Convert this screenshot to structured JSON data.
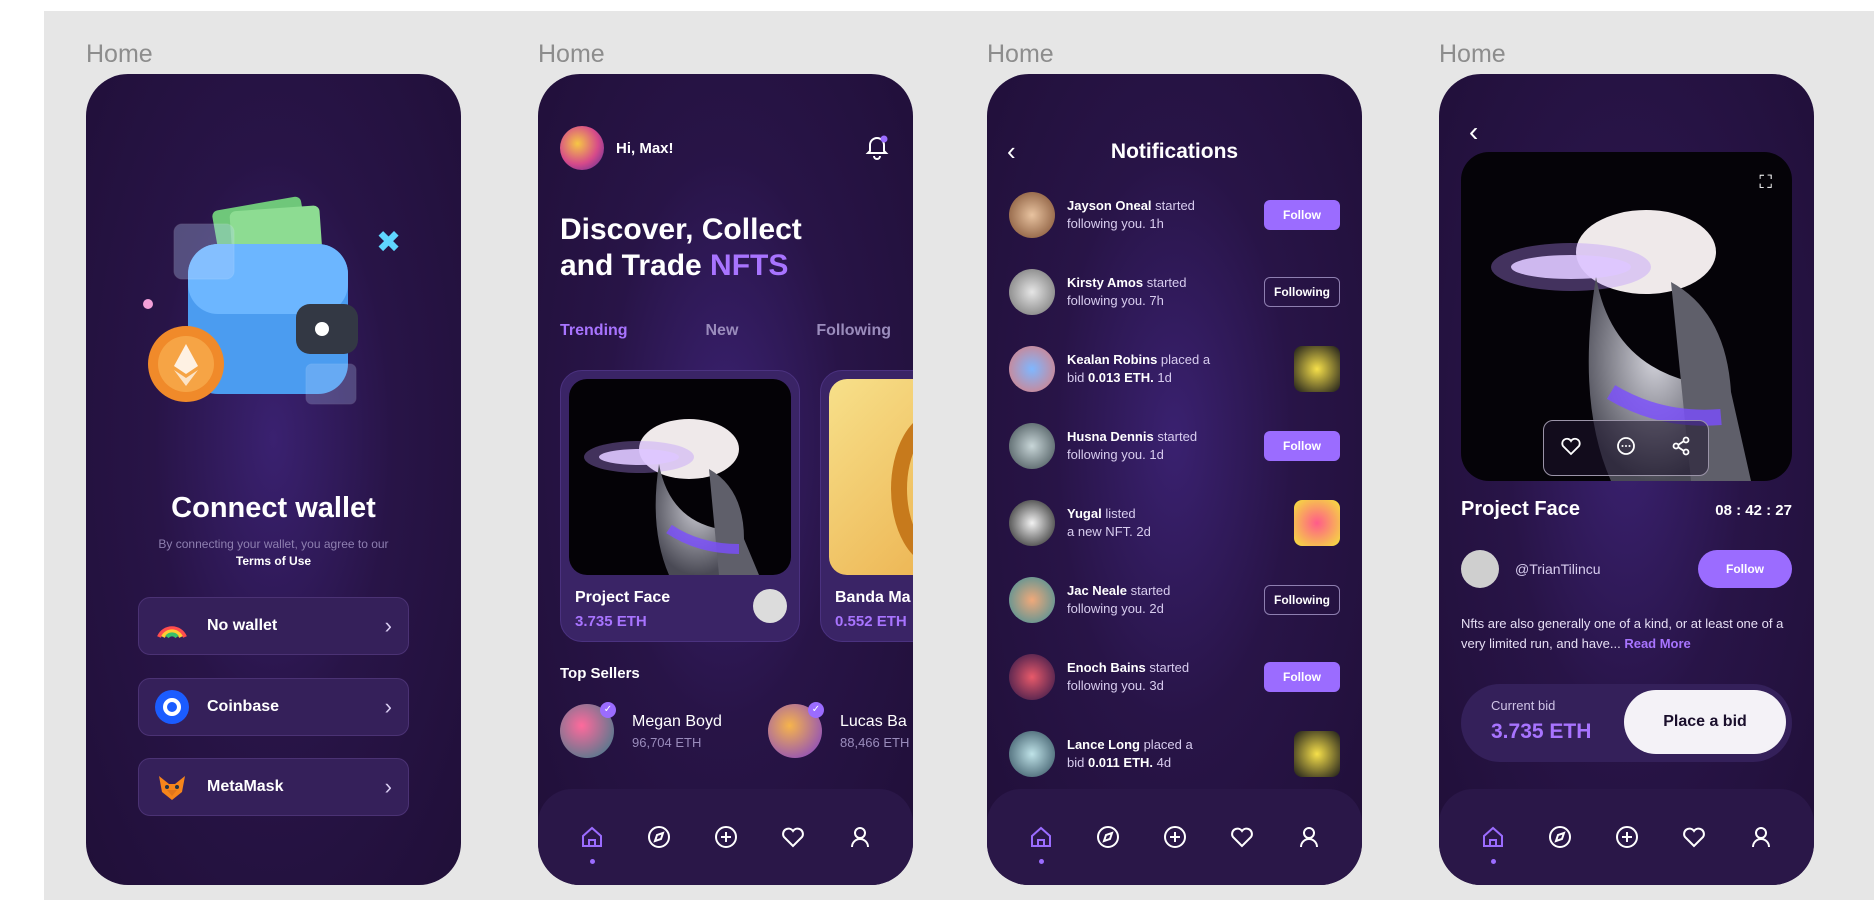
{
  "frame_label": "Home",
  "tabs": [
    "home-icon",
    "compass-icon",
    "plus-circle-icon",
    "heart-icon",
    "user-icon"
  ],
  "connect": {
    "title": "Connect wallet",
    "subtitle": "By connecting your wallet, you agree to our",
    "terms": "Terms of Use",
    "wallets": [
      {
        "label": "No wallet",
        "icon": "rainbow-icon"
      },
      {
        "label": "Coinbase",
        "icon": "coinbase-icon"
      },
      {
        "label": "MetaMask",
        "icon": "metamask-fox-icon"
      }
    ]
  },
  "home": {
    "greeting": "Hi, Max!",
    "title_line1": "Discover, Collect",
    "title_line2": "and Trade ",
    "title_accent": "NFTS",
    "filter_tabs": [
      "Trending",
      "New",
      "Following"
    ],
    "cards": [
      {
        "title": "Project Face",
        "price": "3.735 ETH"
      },
      {
        "title": "Banda Ma",
        "price": "0.552 ETH"
      }
    ],
    "top_sellers_label": "Top Sellers",
    "sellers": [
      {
        "name": "Megan Boyd",
        "eth": "96,704 ETH"
      },
      {
        "name": "Lucas Ba",
        "eth": "88,466 ETH"
      }
    ]
  },
  "notifications": {
    "title": "Notifications",
    "items": [
      {
        "name": "Jayson Oneal",
        "action": "started",
        "line2": "following you. 1h",
        "button": "Follow"
      },
      {
        "name": "Kirsty Amos",
        "action": "started",
        "line2": "following you. 7h",
        "button": "Following"
      },
      {
        "name": "Kealan Robins",
        "action": "placed a",
        "line2_pre": "bid ",
        "line2_bold": "0.013 ETH.",
        "line2_post": " 1d",
        "thumb": true
      },
      {
        "name": "Husna Dennis",
        "action": "started",
        "line2": "following you. 1d",
        "button": "Follow"
      },
      {
        "name": "Yugal",
        "action": "listed",
        "line2": "a new NFT. 2d",
        "thumb": true
      },
      {
        "name": "Jac Neale",
        "action": "started",
        "line2": "following you. 2d",
        "button": "Following"
      },
      {
        "name": "Enoch Bains",
        "action": "started",
        "line2": "following you. 3d",
        "button": "Follow"
      },
      {
        "name": "Lance Long",
        "action": "placed a",
        "line2_pre": "bid ",
        "line2_bold": "0.011 ETH.",
        "line2_post": " 4d",
        "thumb": true
      }
    ]
  },
  "detail": {
    "title": "Project Face",
    "timer": "08 : 42 : 27",
    "owner": "@TrianTilincu",
    "follow": "Follow",
    "description": "Nfts are also generally one of a kind, or at least one of a very limited run, and have...",
    "read_more": "Read More",
    "bid_label": "Current bid",
    "bid_value": "3.735 ETH",
    "bid_button": "Place a bid"
  }
}
